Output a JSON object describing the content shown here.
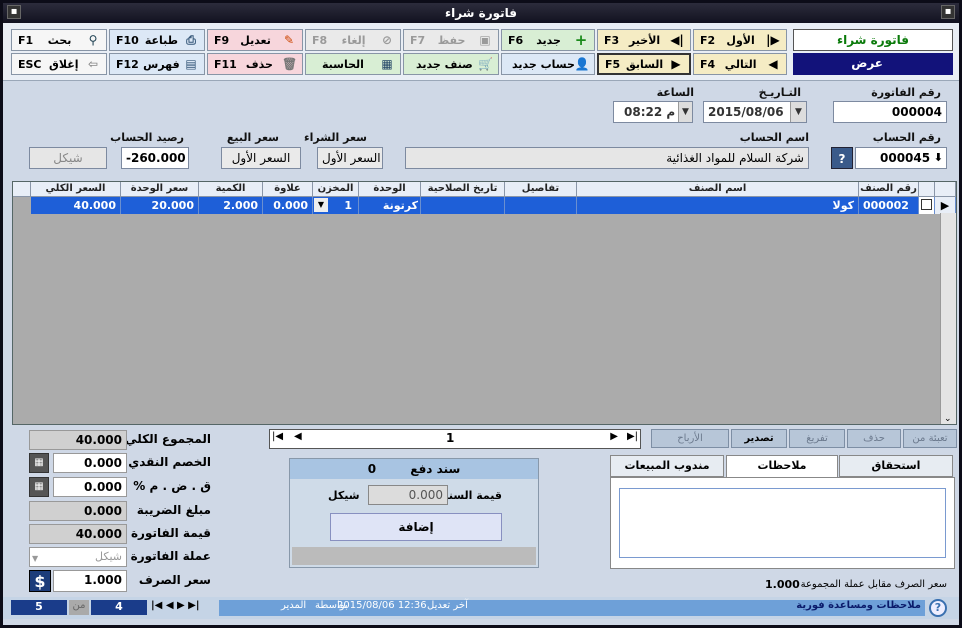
{
  "window": {
    "title": "فاتورة شراء"
  },
  "toolbar": {
    "row1": [
      {
        "label": "بحث",
        "key": "F1",
        "icon": "binoculars-icon"
      },
      {
        "label": "طباعة",
        "key": "F10",
        "icon": "printer-icon"
      },
      {
        "label": "تعديل",
        "key": "F9",
        "icon": "edit-icon"
      },
      {
        "label": "إلغاء",
        "key": "F8",
        "icon": "cancel-icon"
      },
      {
        "label": "حفظ",
        "key": "F7",
        "icon": "save-icon"
      },
      {
        "label": "جديد",
        "key": "F6",
        "icon": "plus-icon"
      },
      {
        "label": "الأخير",
        "key": "F3",
        "icon": "last-icon"
      },
      {
        "label": "الأول",
        "key": "F2",
        "icon": "first-icon"
      }
    ],
    "row2": [
      {
        "label": "إغلاق",
        "key": "ESC",
        "icon": "back-arrow-icon"
      },
      {
        "label": "فهرس",
        "key": "F12",
        "icon": "document-icon"
      },
      {
        "label": "حذف",
        "key": "F11",
        "icon": "trash-icon"
      },
      {
        "label": "الحاسبة",
        "key": "",
        "icon": "calculator-icon"
      },
      {
        "label": "صنف جديد",
        "key": "",
        "icon": "cart-add-icon"
      },
      {
        "label": "حساب جديد",
        "key": "",
        "icon": "user-add-icon"
      },
      {
        "label": "السابق",
        "key": "F5",
        "icon": "prev-icon"
      },
      {
        "label": "التالي",
        "key": "F4",
        "icon": "next-icon"
      }
    ],
    "type_label": "فاتورة شراء",
    "mode_label": "عرض"
  },
  "header": {
    "invoice_no_label": "رقم الفاتورة",
    "invoice_no": "000004",
    "date_label": "التـاريـخ",
    "date": "2015/08/06",
    "time_label": "الساعة",
    "time": "08:22",
    "time_ampm": "م",
    "account_no_label": "رقم الحساب",
    "account_no": "000045",
    "account_name_label": "اسم الحساب",
    "account_name": "شركة السلام للمواد الغذائية",
    "buy_price_label": "سعر الشراء",
    "buy_price": "السعر الأول",
    "sell_price_label": "سعر البيع",
    "sell_price": "السعر الأول",
    "balance_label": "رصيد الحساب",
    "balance": "-260.000",
    "currency": "شيكل"
  },
  "grid": {
    "columns": [
      "رقم الصنف",
      "اسم الصنف",
      "تفاصيل",
      "تاريخ الصلاحية",
      "الوحدة",
      "المخزن",
      "علاوة",
      "الكمية",
      "سعر الوحدة",
      "السعر الكلي"
    ],
    "rows": [
      {
        "item_no": "000002",
        "item_name": "كولا",
        "details": "",
        "expiry": "",
        "unit": "كرتونة",
        "store": "1",
        "bonus": "0.000",
        "qty": "2.000",
        "unit_price": "20.000",
        "total": "40.000"
      }
    ]
  },
  "grid_actions": {
    "fill_from": "تعبئة من",
    "delete": "حذف",
    "empty": "تفريغ",
    "export": "تصدير",
    "profits": "الأرباح",
    "page": "1"
  },
  "totals": {
    "total_label": "المجموع الكلي",
    "total": "40.000",
    "cash_discount_label": "الخصم النقدي",
    "cash_discount": "0.000",
    "vat_label": "ق . ض . م  %",
    "vat": "0.000",
    "tax_amount_label": "مبلغ الضريبة",
    "tax_amount": "0.000",
    "invoice_value_label": "قيمة الفاتورة",
    "invoice_value": "40.000",
    "invoice_currency_label": "عملة الفاتورة",
    "invoice_currency": "شيكل",
    "rate_label": "سعر الصرف",
    "rate": "1.000"
  },
  "voucher": {
    "title": "سند دفع",
    "number": "0",
    "value_label": "قيمة السند",
    "value": "0.000",
    "currency": "شيكل",
    "add_label": "إضافة"
  },
  "tabs": {
    "items": [
      "استحقاق",
      "ملاحظات",
      "مندوب المبيعات"
    ],
    "group_rate_label": "سعر الصرف مقابل عملة المجموعة",
    "group_rate": "1.000"
  },
  "status": {
    "help": "ملاحظات ومساعدة فورية",
    "modified_label": "آخر تعديل",
    "modified": "2015/08/06 12:36",
    "by_label": "بواسطة",
    "by": "المدير",
    "page_current": "4",
    "page_of": "من",
    "page_total": "5",
    "nav": "|◀ ◀ ▶ ▶|"
  }
}
